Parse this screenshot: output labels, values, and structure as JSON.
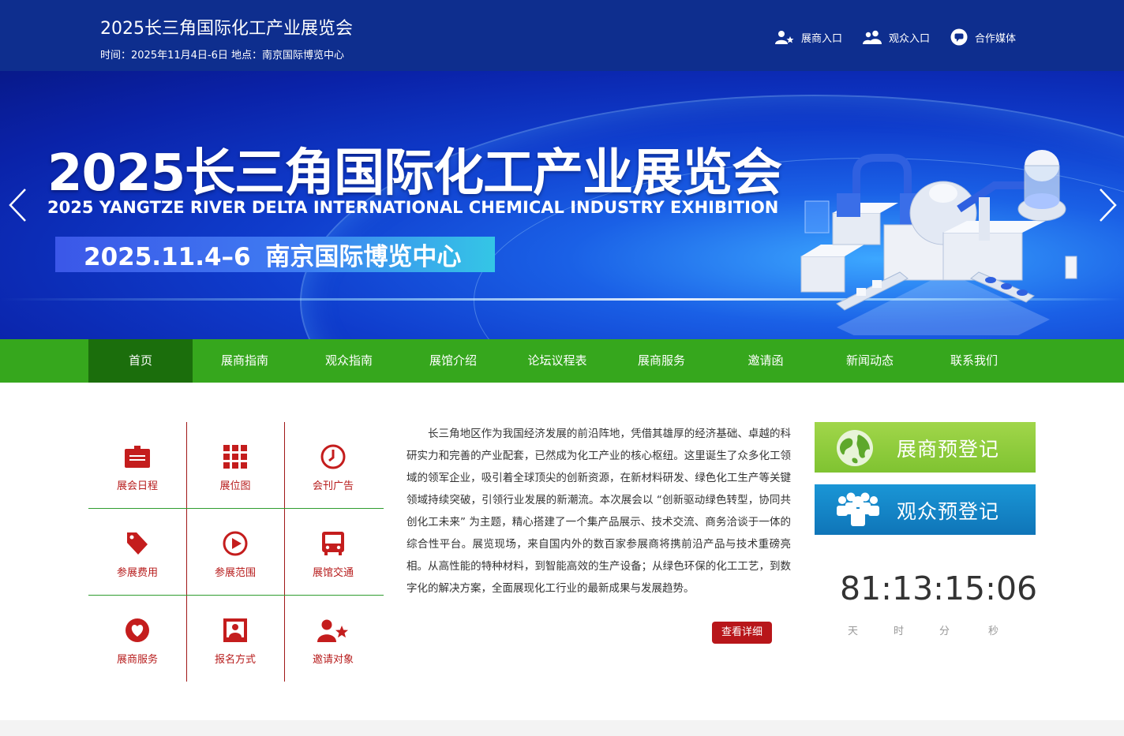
{
  "header": {
    "title": "2025长三角国际化工产业展览会",
    "subtitle": "时间：2025年11月4日-6日 地点：南京国际博览中心",
    "links": [
      {
        "label": "展商入口",
        "icon": "exhibitor-star-icon"
      },
      {
        "label": "观众入口",
        "icon": "visitors-icon"
      },
      {
        "label": "合作媒体",
        "icon": "chat-bubble-icon"
      }
    ]
  },
  "banner": {
    "title": "2025长三角国际化工产业展览会",
    "english_title": "2025 YANGTZE RIVER DELTA INTERNATIONAL CHEMICAL INDUSTRY EXHIBITION",
    "date_venue": "2025.11.4–6 南京国际博览中心"
  },
  "nav": {
    "items": [
      "首页",
      "展商指南",
      "观众指南",
      "展馆介绍",
      "论坛议程表",
      "展商服务",
      "邀请函",
      "新闻动态",
      "联系我们"
    ],
    "active": "首页",
    "color": "#36a71d",
    "active_color": "#1b6e0c"
  },
  "quick_links": [
    {
      "label": "展会日程",
      "icon": "calendar-icon"
    },
    {
      "label": "展位图",
      "icon": "grid-icon"
    },
    {
      "label": "会刊广告",
      "icon": "clock-icon"
    },
    {
      "label": "参展费用",
      "icon": "price-tag-icon"
    },
    {
      "label": "参展范围",
      "icon": "play-icon"
    },
    {
      "label": "展馆交通",
      "icon": "bus-icon"
    },
    {
      "label": "展商服务",
      "icon": "heart-icon"
    },
    {
      "label": "报名方式",
      "icon": "portrait-icon"
    },
    {
      "label": "邀请对象",
      "icon": "person-star-icon"
    }
  ],
  "intro": {
    "text": "长三角地区作为我国经济发展的前沿阵地，凭借其雄厚的经济基础、卓越的科研实力和完善的产业配套，已然成为化工产业的核心枢纽。这里诞生了众多化工领域的领军企业，吸引着全球顶尖的创新资源，在新材料研发、绿色化工生产等关键领域持续突破，引领行业发展的新潮流。本次展会以 “创新驱动绿色转型，协同共创化工未来” 为主题，精心搭建了一个集产品展示、技术交流、商务洽谈于一体的综合性平台。展览现场，来自国内外的数百家参展商将携前沿产品与技术重磅亮相。从高性能的特种材料，到智能高效的生产设备；从绿色环保的化工工艺，到数字化的解决方案，全面展现化工行业的最新成果与发展趋势。",
    "button": "查看详细"
  },
  "register": {
    "exhibitor": "展商预登记",
    "visitor": "观众预登记"
  },
  "countdown": {
    "display": "81:13:15:06",
    "units": [
      "天",
      "时",
      "分",
      "秒"
    ]
  }
}
